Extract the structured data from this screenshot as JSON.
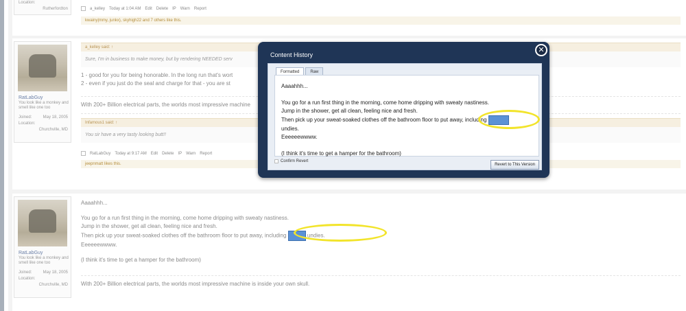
{
  "post1": {
    "location_label": "Location:",
    "location_value": "Rutherfordton",
    "author": "a_kelley",
    "time": "Today at 1:04 AM",
    "actions": [
      "Edit",
      "Delete",
      "IP",
      "Warn",
      "Report"
    ],
    "likes_text": "kwainy|mmy, junkx), skyhigh22 and 7 others like this."
  },
  "post2": {
    "user": {
      "name": "RatLabGuy",
      "title": "You look like a monkey and smell like one too",
      "joined_label": "Joined:",
      "joined_value": "May 18, 2005",
      "location_label": "Location:",
      "location_value": "Churchville, MD"
    },
    "quote1_head": "a_kelley said: ↑",
    "quote1_body": "Sure, I'm in business to make money, but by rendering NEEDED serv",
    "line1": "1 - good for you for being honorable. In the long run that's wort",
    "line2": "2 - even if you just do the seal and charge for that - you are st",
    "signature": "With 200+ Billion electrical parts, the worlds most impressive machine",
    "quote2_head": "Infamous1 said: ↑",
    "quote2_body": "You sir have a very tasty looking butt!!",
    "author": "RatLabGuy",
    "time": "Today at 9:17 AM",
    "actions": [
      "Edit",
      "Delete",
      "IP",
      "Warn",
      "Report"
    ],
    "likes_text": "jeepnmatt likes this."
  },
  "post3": {
    "user": {
      "name": "RatLabGuy",
      "title": "You look like a monkey and smell like one too",
      "joined_label": "Joined:",
      "joined_value": "May 18, 2005",
      "location_label": "Location:",
      "location_value": "Churchville, MD"
    },
    "line_a": "Aaaahhh...",
    "line_b": "You go for a run first thing in the morning, come home dripping with sweaty nastiness.",
    "line_c": "Jump in the shower, get all clean, feeling nice and fresh.",
    "line_d_pre": "Then pick up your sweat-soaked clothes off the bathroom floor to put away, including",
    "line_d_post": "undies.",
    "line_e": "Eeeeeewwww.",
    "line_f": "(I think it's time to get a hamper for the bathroom)",
    "signature": "With 200+ Billion electrical parts, the worlds most impressive machine is inside your own skull."
  },
  "modal": {
    "title": "Content History",
    "close_symbol": "✕",
    "tabs": [
      "Formatted",
      "Raw"
    ],
    "line_a": "Aaaahhh...",
    "line_b": "You go for a run first thing in the morning, come home dripping with sweaty nastiness.",
    "line_c": "Jump in the shower, get all clean, feeling nice and fresh.",
    "line_d": "Then pick up your sweat-soaked clothes off the bathroom floor to put away, including",
    "line_e": "undies.",
    "line_f": "Eeeeeewwww.",
    "line_g": "(I think it's time to get a hamper for the bathroom)",
    "confirm_label": "Confirm Revert",
    "revert_button": "Revert to This Version"
  },
  "colors": {
    "highlight": "#f2e42b",
    "redaction": "#5b92d6",
    "modal_bg": "#1f3556"
  }
}
